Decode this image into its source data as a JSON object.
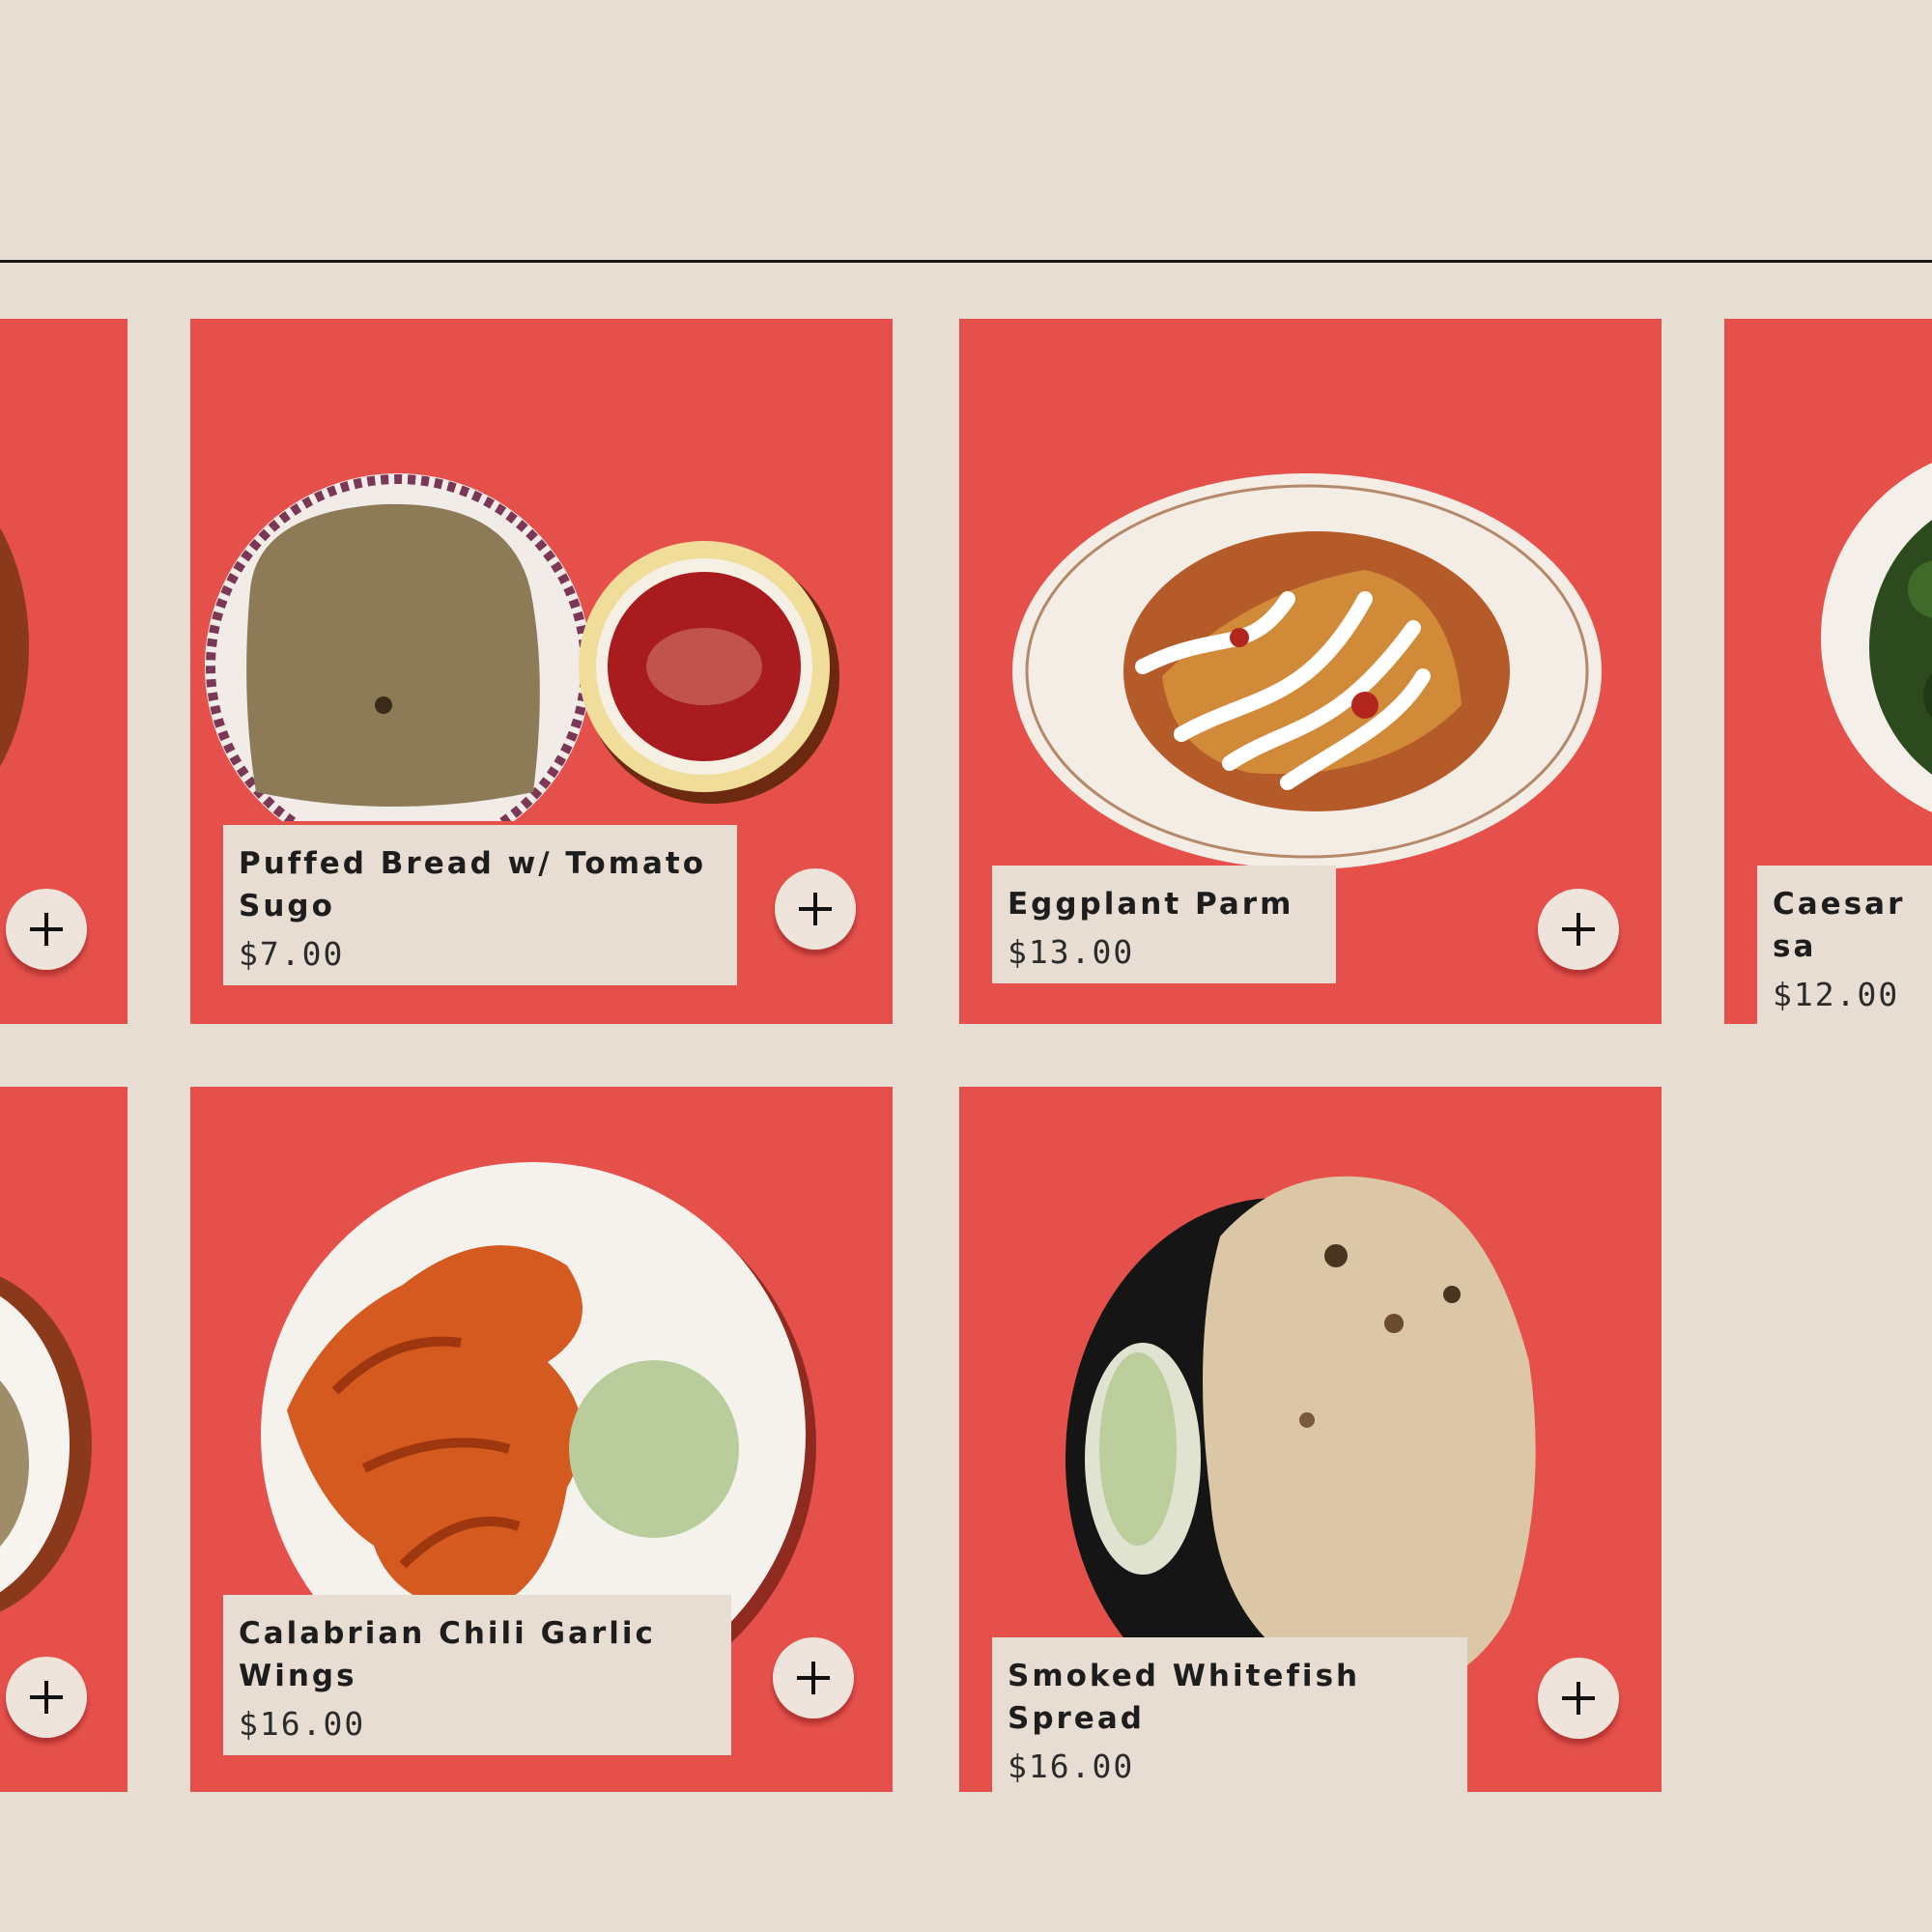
{
  "menu": {
    "row1": [
      {
        "title": "",
        "price": ""
      },
      {
        "title": "Puffed Bread w/ Tomato Sugo",
        "price": "$7.00"
      },
      {
        "title": "Eggplant Parm",
        "price": "$13.00"
      },
      {
        "title": "Caesar sa",
        "price": "$12.00"
      }
    ],
    "row2": [
      {
        "title": "",
        "price": ""
      },
      {
        "title": "Calabrian Chili Garlic Wings",
        "price": "$16.00"
      },
      {
        "title": "Smoked Whitefish Spread",
        "price": "$16.00"
      }
    ]
  },
  "colors": {
    "background": "#e8ddd3",
    "card": "#e5504b",
    "caption": "#e8ddd3",
    "divider": "#1b1b1b"
  },
  "icons": {
    "add": "plus-icon"
  }
}
